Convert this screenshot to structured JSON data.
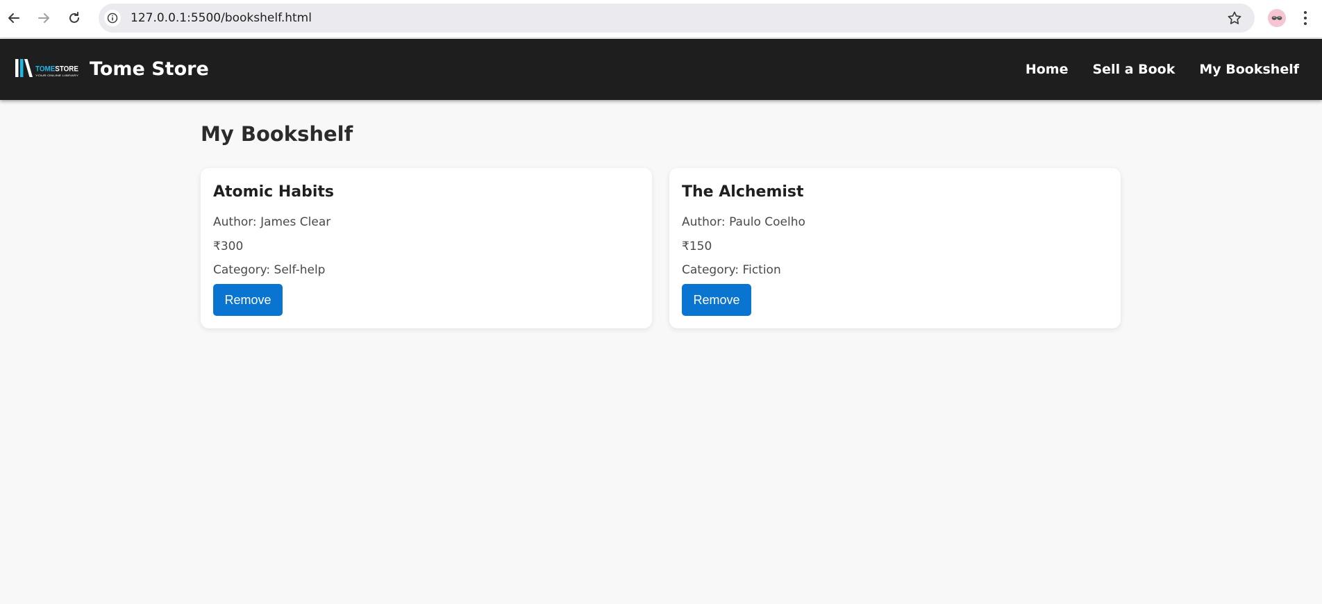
{
  "browser": {
    "url": "127.0.0.1:5500/bookshelf.html"
  },
  "header": {
    "logo_text": "TOMESTORE",
    "logo_tagline": "YOUR ONLINE LIBRARY",
    "brand": "Tome Store",
    "nav": [
      {
        "label": "Home"
      },
      {
        "label": "Sell a Book"
      },
      {
        "label": "My Bookshelf"
      }
    ]
  },
  "main": {
    "title": "My Bookshelf",
    "books": [
      {
        "title": "Atomic Habits",
        "author": "Author: James Clear",
        "price": "₹300",
        "category": "Category: Self-help",
        "button": "Remove"
      },
      {
        "title": "The Alchemist",
        "author": "Author: Paulo Coelho",
        "price": "₹150",
        "category": "Category: Fiction",
        "button": "Remove"
      }
    ]
  },
  "colors": {
    "header_bg": "#1e1e1e",
    "page_bg": "#f8f8f8",
    "accent_button": "#0a74d1",
    "logo_cyan": "#1cb7e6"
  }
}
